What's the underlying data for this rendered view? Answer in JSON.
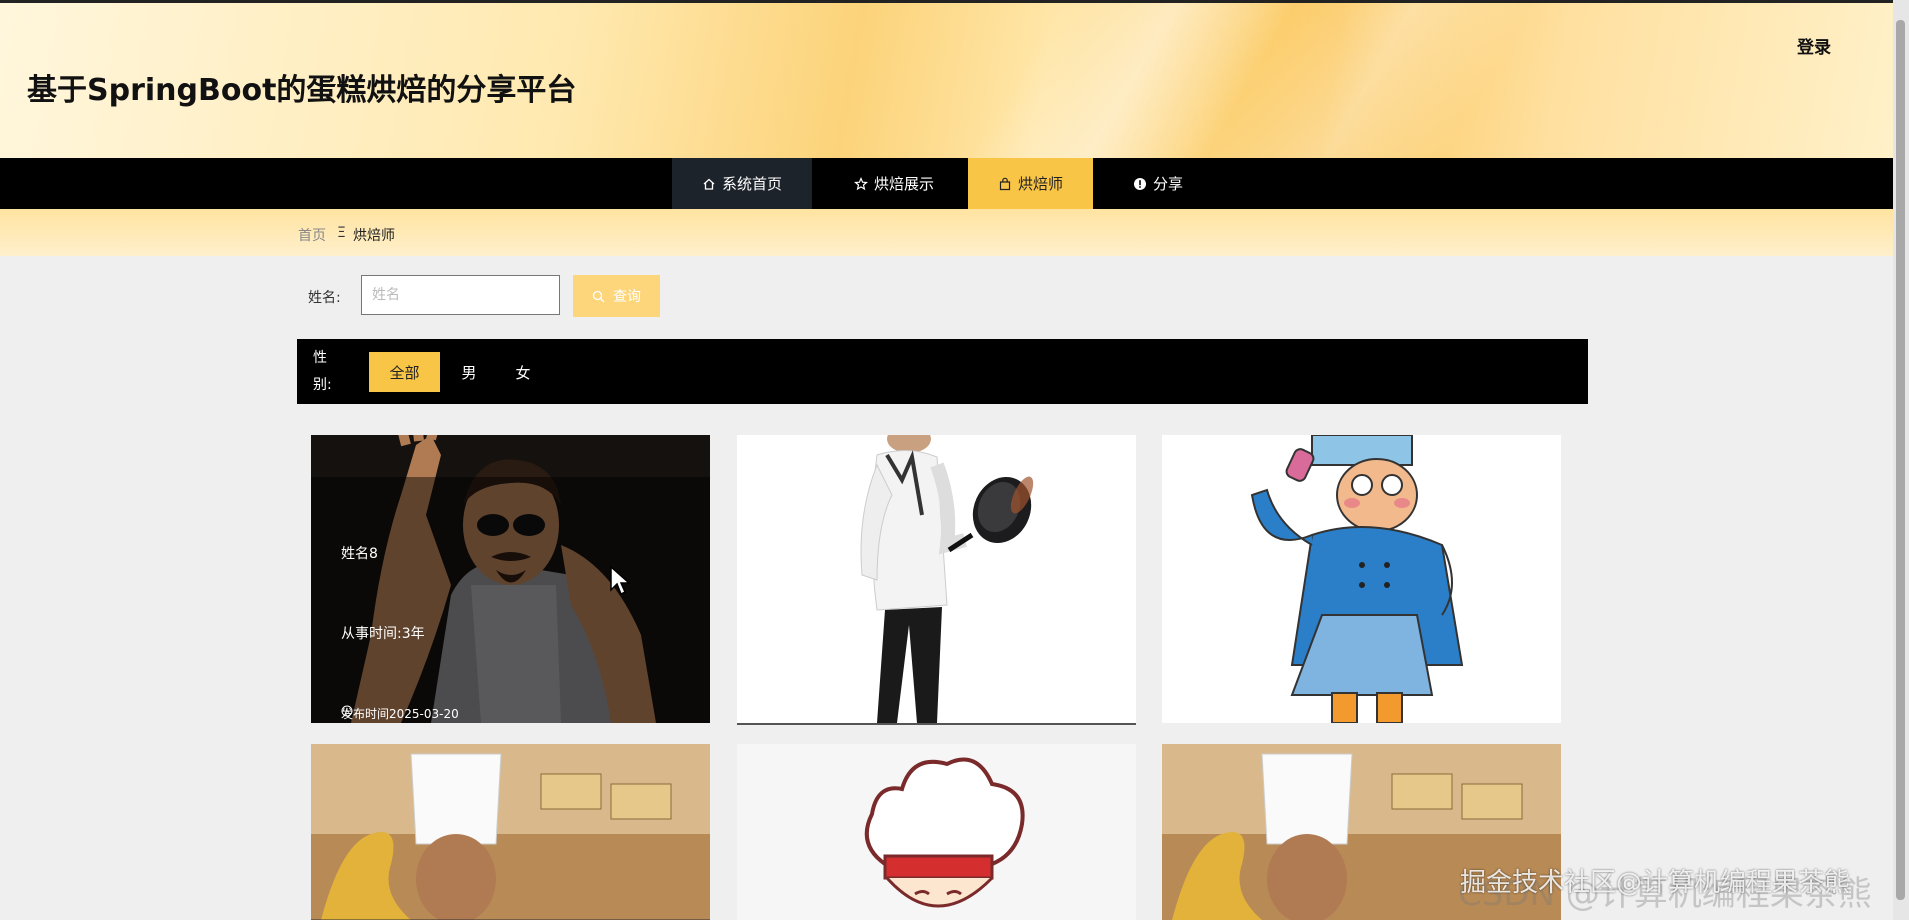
{
  "header": {
    "site_title": "基于SpringBoot的蛋糕烘焙的分享平台",
    "login_label": "登录"
  },
  "nav": {
    "items": [
      {
        "label": "系统首页",
        "icon": "home-icon"
      },
      {
        "label": "烘焙展示",
        "icon": "star-icon"
      },
      {
        "label": "烘焙师",
        "icon": "bag-icon",
        "active": true
      },
      {
        "label": "分享",
        "icon": "info-icon"
      }
    ]
  },
  "breadcrumb": {
    "home": "首页",
    "separator": "Ξ",
    "current": "烘焙师"
  },
  "search": {
    "label": "姓名:",
    "placeholder": "姓名",
    "value": "",
    "button_label": "查询"
  },
  "filter": {
    "label": "性别:",
    "options": [
      "全部",
      "男",
      "女"
    ],
    "selected": "全部"
  },
  "cards": [
    {
      "name": "姓名8",
      "years": "从事时间:3年",
      "published": "发布时间2025-03-20",
      "image": "mustached-chef-photo"
    },
    {
      "image": "chef-with-pan-photo"
    },
    {
      "image": "cartoon-chef-blue"
    },
    {
      "image": "chef-dragon-photo"
    },
    {
      "image": "cartoon-chef-hat"
    },
    {
      "image": "chef-dragon-photo"
    }
  ],
  "watermark": {
    "text": "掘金技术社区@计算机编程果茶熊",
    "background_text": "CSDN @计算机编程果茶熊"
  },
  "colors": {
    "accent": "#f9c546",
    "nav_bg": "#000000",
    "search_button": "#fdd57b"
  }
}
